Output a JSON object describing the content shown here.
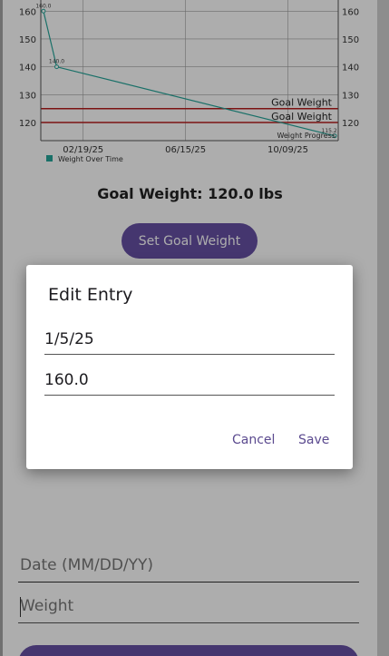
{
  "chart_data": {
    "type": "line",
    "series": [
      {
        "name": "Weight Over Time",
        "color": "#26a69a",
        "points": [
          {
            "x": "1/5/25",
            "y": 160.0,
            "label": "160.0"
          },
          {
            "x": "1/20/25",
            "y": 140.0,
            "label": "140.0"
          },
          {
            "x": "12/1/25",
            "y": 115.2,
            "label": "115.2"
          }
        ]
      }
    ],
    "goal_lines": [
      {
        "y": 125.0,
        "label": "Goal Weight",
        "color": "#b71c1c"
      },
      {
        "y": 120.0,
        "label": "Goal Weight",
        "color": "#b71c1c"
      }
    ],
    "y_ticks": [
      "160",
      "150",
      "140",
      "130",
      "120"
    ],
    "x_ticks": [
      "02/19/25",
      "06/15/25",
      "10/09/25"
    ],
    "description": "Weight Progress",
    "legend": "Weight Over Time",
    "legend_position": "bottom-left",
    "grid": true
  },
  "goal_weight_text": "Goal Weight: 120.0 lbs",
  "set_goal_button": "Set Goal Weight",
  "date_field": {
    "placeholder": "Date (MM/DD/YY)"
  },
  "weight_field": {
    "placeholder": "Weight"
  },
  "dialog": {
    "title": "Edit Entry",
    "date_value": "1/5/25",
    "weight_value": "160.0",
    "cancel": "Cancel",
    "save": "Save"
  },
  "colors": {
    "accent": "#6650a4",
    "line": "#26a69a",
    "goal": "#b71c1c"
  }
}
